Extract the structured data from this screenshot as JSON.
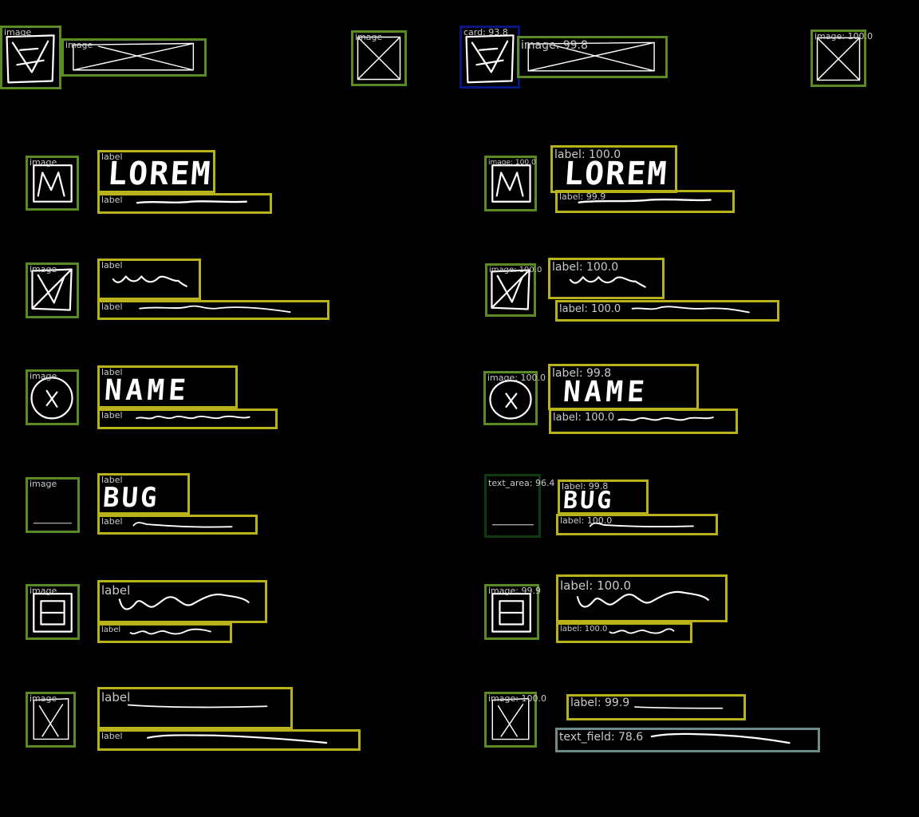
{
  "left_panel": {
    "header": {
      "img1": "image",
      "img2": "image",
      "img3": "image"
    },
    "rows": [
      {
        "image": "image",
        "title": "label",
        "subtitle": "label",
        "word": "LOREM"
      },
      {
        "image": "image",
        "title": "label",
        "subtitle": "label"
      },
      {
        "image": "image",
        "title": "label",
        "subtitle": "label",
        "word": "NAME"
      },
      {
        "image": "image",
        "title": "label",
        "subtitle": "label",
        "word": "BUG"
      },
      {
        "image": "image",
        "title": "label",
        "subtitle": "label"
      },
      {
        "image": "image",
        "title": "label",
        "subtitle": "label"
      }
    ]
  },
  "right_panel": {
    "header": {
      "card": "card: 93.8",
      "img2": "image: 99.8",
      "img3": "image: 100.0"
    },
    "rows": [
      {
        "image": "image: 100.0",
        "title": "label: 100.0",
        "subtitle": "label: 99.9",
        "word": "LOREM"
      },
      {
        "image": "image: 100.0",
        "title": "label: 100.0",
        "subtitle": "label: 100.0"
      },
      {
        "image": "image: 100.0",
        "title": "label: 99.8",
        "subtitle": "label: 100.0",
        "word": "NAME"
      },
      {
        "image": "text_area: 96.4",
        "title": "label: 99.8",
        "subtitle": "label: 100.0",
        "word": "BUG"
      },
      {
        "image": "image: 99.9",
        "title": "label: 100.0",
        "subtitle": "label: 100.0"
      },
      {
        "image": "image: 100.0",
        "title": "label: 99.9",
        "subtitle": "text_field: 78.6"
      }
    ]
  },
  "colors": {
    "image": "#5b8a22",
    "label": "#b8b31a",
    "card": "#0b157f",
    "text_area": "#0f3a10",
    "text_field": "#6d8a86"
  }
}
